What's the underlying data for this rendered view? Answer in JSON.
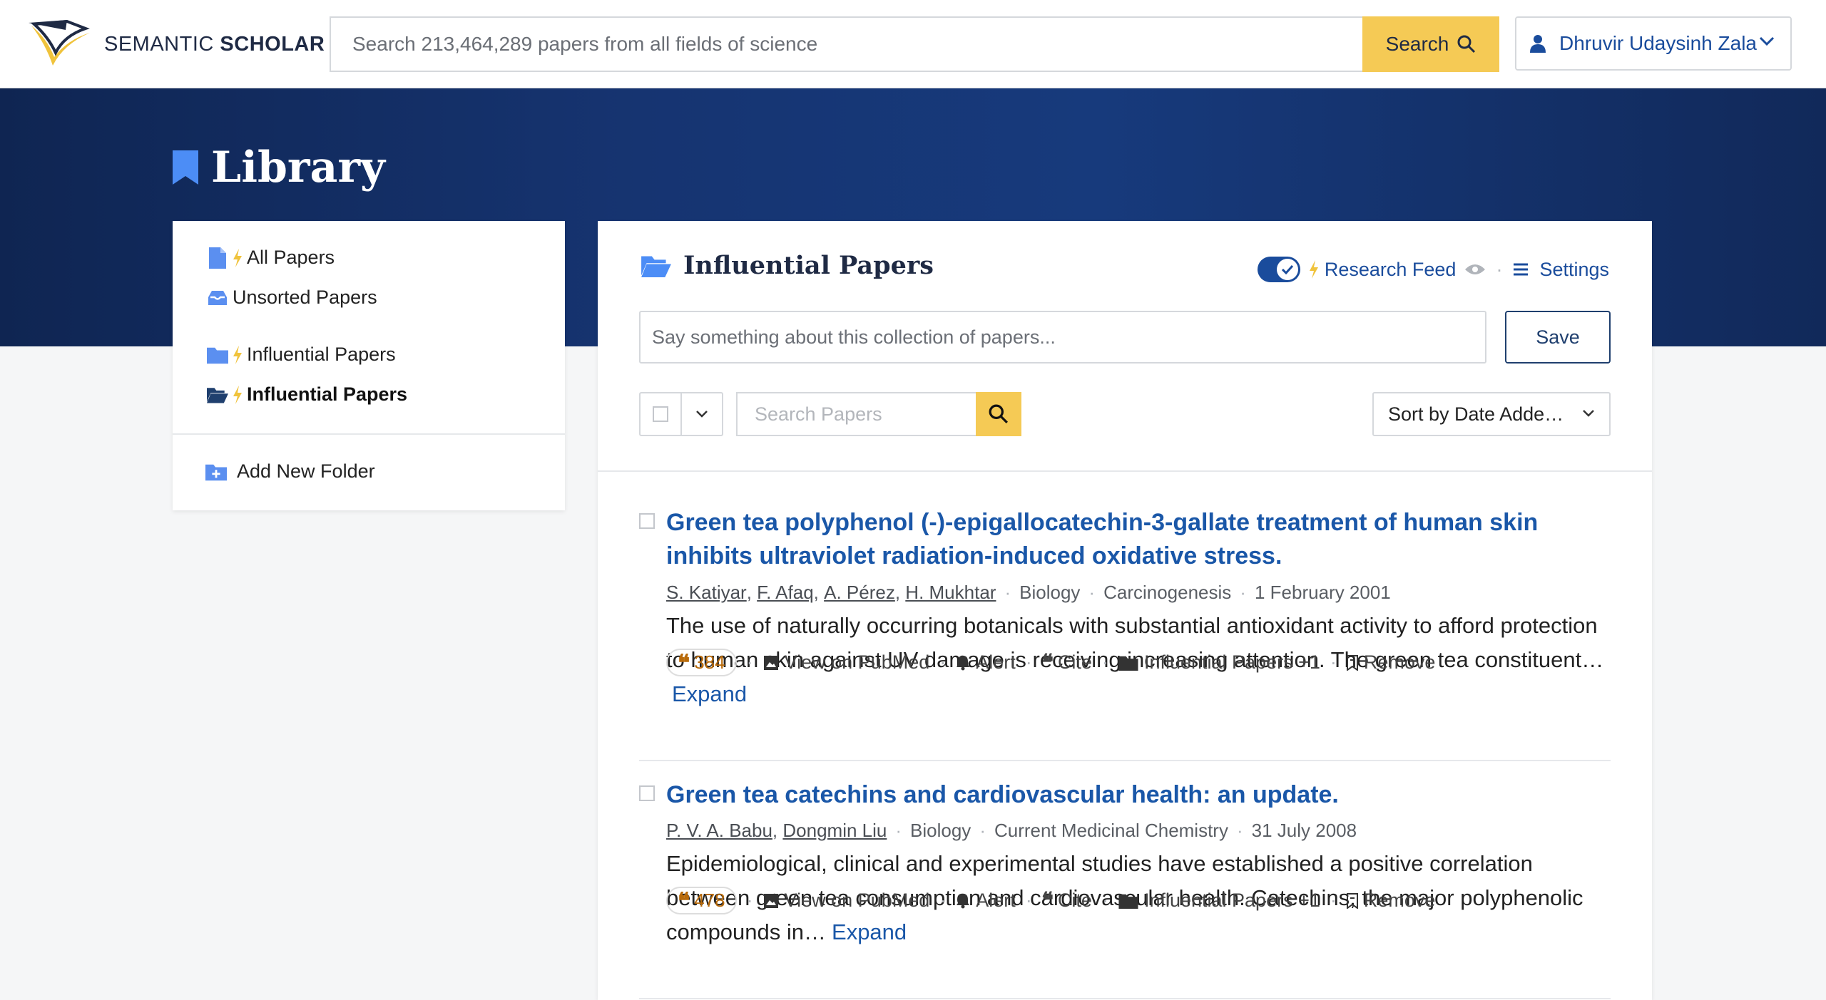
{
  "header": {
    "logo_text_light": "SEMANTIC",
    "logo_text_bold": "SCHOLAR",
    "search_placeholder": "Search 213,464,289 papers from all fields of science",
    "search_button": "Search",
    "user_name": "Dhruvir Udaysinh Zala"
  },
  "hero": {
    "title": "Library"
  },
  "sidebar": {
    "items": [
      {
        "label": "All Papers",
        "icon": "document-icon",
        "bolt": true
      },
      {
        "label": "Unsorted Papers",
        "icon": "inbox-icon",
        "bolt": false
      },
      {
        "label": "Influential Papers",
        "icon": "folder-icon",
        "bolt": true
      },
      {
        "label": "Influential Papers",
        "icon": "folder-open-icon",
        "bolt": true,
        "active": true
      }
    ],
    "add_folder": "Add New Folder"
  },
  "main": {
    "folder_title": "Influential Papers",
    "research_feed_label": "Research Feed",
    "settings_label": "Settings",
    "description_placeholder": "Say something about this collection of papers...",
    "save_button": "Save",
    "search_papers_placeholder": "Search Papers",
    "sort_label": "Sort by Date Adde…",
    "colors": {
      "accent": "#1a4c9c",
      "search": "#f5ca55",
      "citation": "#b86a0a"
    }
  },
  "papers": [
    {
      "title": "Green tea polyphenol (-)-epigallocatechin-3-gallate treatment of human skin inhibits ultraviolet radiation-induced oxidative stress.",
      "authors": [
        "S. Katiyar",
        "F. Afaq",
        "A. Pérez",
        "H. Mukhtar"
      ],
      "field": "Biology",
      "venue": "Carcinogenesis",
      "date": "1 February 2001",
      "abstract": "The use of naturally occurring botanicals with substantial antioxidant activity to afford protection to human skin against UV damage is receiving increasing attention. The green tea constituent…",
      "expand": "Expand",
      "citations": "384",
      "view": "View on PubMed",
      "alert": "Alert",
      "cite": "Cite",
      "folders": "Influential Papers +1",
      "remove": "Remove"
    },
    {
      "title": "Green tea catechins and cardiovascular health: an update.",
      "authors": [
        "P. V. A. Babu",
        "Dongmin Liu"
      ],
      "field": "Biology",
      "venue": "Current Medicinal Chemistry",
      "date": "31 July 2008",
      "abstract": "Epidemiological, clinical and experimental studies have established a positive correlation between green tea consumption and cardiovascular health. Catechins, the major polyphenolic compounds in…",
      "expand": "Expand",
      "citations": "478",
      "view": "View on PubMed",
      "alert": "Alert",
      "cite": "Cite",
      "folders": "Influential Papers +1",
      "remove": "Remove"
    }
  ]
}
